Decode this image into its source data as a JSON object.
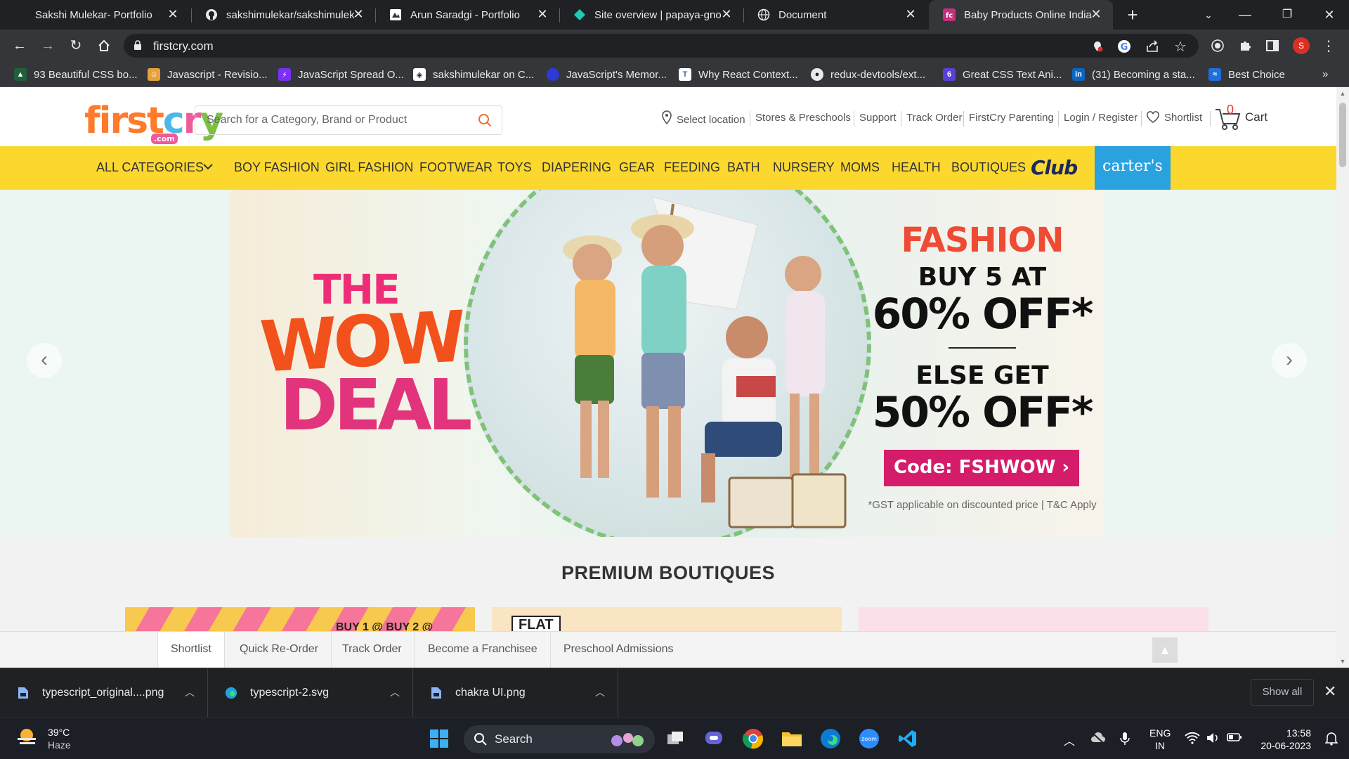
{
  "browser": {
    "tabs": [
      {
        "title": "Sakshi Mulekar- Portfolio",
        "icon": "portfolio-icon"
      },
      {
        "title": "sakshimulekar/sakshimulek",
        "icon": "github-icon"
      },
      {
        "title": "Arun Saradgi - Portfolio",
        "icon": "portfolio-icon"
      },
      {
        "title": "Site overview | papaya-gno",
        "icon": "netlify-icon"
      },
      {
        "title": "Document",
        "icon": "globe-icon"
      },
      {
        "title": "Baby Products Online India",
        "icon": "firstcry-icon"
      }
    ],
    "new_tab": "+",
    "url": "firstcry.com",
    "profile_initial": "S",
    "bookmarks": [
      "93 Beautiful CSS bo...",
      "Javascript - Revisio...",
      "JavaScript Spread O...",
      "sakshimulekar on C...",
      "JavaScript's Memor...",
      "Why React Context...",
      "redux-devtools/ext...",
      "Great CSS Text Ani...",
      "(31) Becoming a sta...",
      "Best Choice"
    ],
    "bookmarks_overflow": "»"
  },
  "site": {
    "logo": {
      "letters": [
        "first",
        "c",
        "r",
        "y"
      ],
      "com": ".com"
    },
    "search_placeholder": "Search for a Category, Brand or Product",
    "top_links": {
      "location": "Select location",
      "stores": "Stores & Preschools",
      "support": "Support",
      "track": "Track Order",
      "parenting": "FirstCry Parenting",
      "login": "Login / Register",
      "shortlist": "Shortlist",
      "cart_count": "0",
      "cart": "Cart"
    },
    "categories": [
      "ALL CATEGORIES",
      "BOY FASHION",
      "GIRL FASHION",
      "FOOTWEAR",
      "TOYS",
      "DIAPERING",
      "GEAR",
      "FEEDING",
      "BATH",
      "NURSERY",
      "MOMS",
      "HEALTH",
      "BOUTIQUES"
    ],
    "club": "Club",
    "carters": "carter's",
    "banner": {
      "wow_line1": "THE",
      "wow_line2": "WOW",
      "wow_line3": "DEAL",
      "heading": "FASHION",
      "offer1_line": "BUY 5 AT",
      "offer1_value": "60% OFF*",
      "offer2_line": "ELSE GET",
      "offer2_value": "50% OFF*",
      "code": "Code: FSHWOW ›",
      "note": "*GST applicable on discounted price | T&C Apply"
    },
    "section_title": "PREMIUM BOUTIQUES",
    "boutique_snippets": {
      "card1": "BUY 1 @   BUY 2 @",
      "card2": "FLAT"
    },
    "bottom_links": [
      "Shortlist",
      "Quick Re-Order",
      "Track Order",
      "Become a Franchisee",
      "Preschool Admissions"
    ]
  },
  "downloads": {
    "items": [
      {
        "name": "typescript_original....png",
        "icon": "image-file-icon"
      },
      {
        "name": "typescript-2.svg",
        "icon": "edge-icon"
      },
      {
        "name": "chakra UI.png",
        "icon": "image-file-icon"
      }
    ],
    "show_all": "Show all"
  },
  "taskbar": {
    "temperature": "39°C",
    "condition": "Haze",
    "search": "Search",
    "lang_line1": "ENG",
    "lang_line2": "IN",
    "time": "13:58",
    "date": "20-06-2023"
  },
  "colors": {
    "catbar": "#fcd82f",
    "carters": "#2aa2e0",
    "promo_code_bg": "#d51c6a",
    "promo_heading": "#ef4a33",
    "chrome_dark": "#202124"
  }
}
